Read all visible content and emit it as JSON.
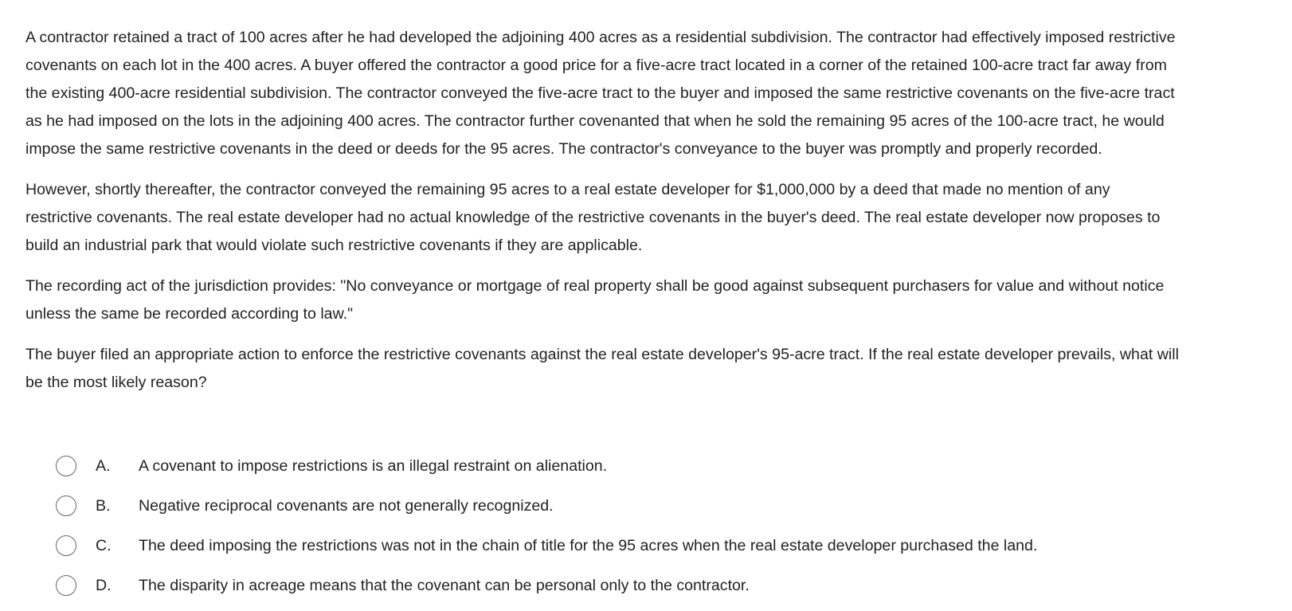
{
  "question": {
    "paragraphs": [
      "A contractor retained a tract of 100 acres after he had developed the adjoining 400 acres as a residential subdivision.  The contractor had effectively imposed restrictive covenants on each lot in the 400 acres.  A buyer offered the contractor a good price for a five-acre tract located in a corner of the retained 100-acre tract far away from the existing 400-acre residential subdivision.  The contractor conveyed the five-acre tract to the buyer and imposed the same restrictive covenants on the five-acre tract as he had imposed on the lots in the adjoining 400 acres.  The contractor further covenanted that when he sold the remaining 95 acres of the 100-acre tract, he would impose the same restrictive covenants in the deed or deeds for the 95 acres.  The contractor's conveyance to the buyer was promptly and properly recorded.",
      "However, shortly thereafter, the contractor conveyed the remaining 95 acres to a real estate developer for $1,000,000 by a deed that made no mention of any restrictive covenants.  The real estate developer had no actual knowledge of the restrictive covenants in the buyer's deed.  The real estate developer now proposes to build an industrial park that would violate such restrictive covenants if they are applicable.",
      "The recording act of the jurisdiction provides: \"No conveyance or mortgage of real property shall be good against subsequent purchasers for value and without notice unless the same be recorded according to law.\"",
      "The buyer filed an appropriate action to enforce the restrictive covenants against the real estate developer's 95-acre tract.  If the real estate developer prevails, what will be the most likely reason?"
    ]
  },
  "options": [
    {
      "letter": "A.",
      "text": "A covenant to impose restrictions is an illegal restraint on alienation.",
      "selected": false
    },
    {
      "letter": "B.",
      "text": "Negative reciprocal covenants are not generally recognized.",
      "selected": false
    },
    {
      "letter": "C.",
      "text": "The deed imposing the restrictions was not in the chain of title for the 95 acres when the real estate developer purchased the land.",
      "selected": false
    },
    {
      "letter": "D.",
      "text": "The disparity in acreage means that the covenant can be personal only to the contractor.",
      "selected": false
    }
  ],
  "colors": {
    "text": "#222222",
    "radio_border": "#666666",
    "background": "#ffffff"
  }
}
